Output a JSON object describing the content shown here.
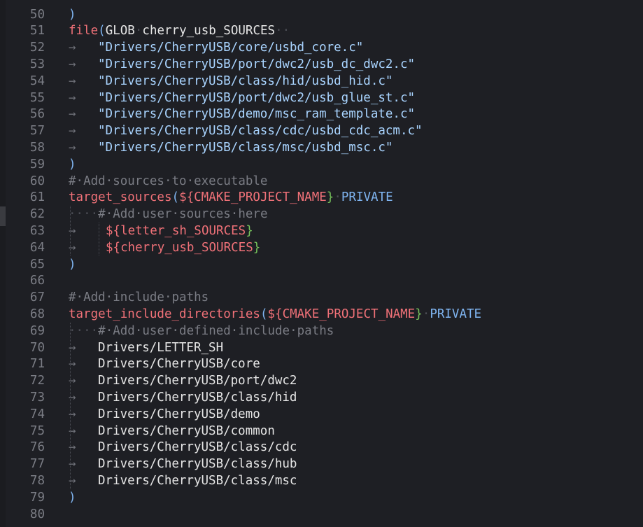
{
  "editor": {
    "language": "cmake",
    "lines": [
      {
        "n": "50",
        "tokens": [
          {
            "t": "paren",
            "v": ")"
          }
        ]
      },
      {
        "n": "51",
        "tokens": [
          {
            "t": "fn",
            "v": "file"
          },
          {
            "t": "paren",
            "v": "("
          },
          {
            "t": "pl",
            "v": "GLOB"
          },
          {
            "t": "ws",
            "v": "·"
          },
          {
            "t": "pl",
            "v": "cherry_usb_SOURCES"
          },
          {
            "t": "ws",
            "v": "·"
          },
          {
            "t": "ws",
            "v": "·"
          }
        ]
      },
      {
        "n": "52",
        "indent": "tab",
        "tokens": [
          {
            "t": "str",
            "v": "\"Drivers/CherryUSB/core/usbd_core.c\""
          }
        ]
      },
      {
        "n": "53",
        "indent": "tab",
        "tokens": [
          {
            "t": "str",
            "v": "\"Drivers/CherryUSB/port/dwc2/usb_dc_dwc2.c\""
          }
        ]
      },
      {
        "n": "54",
        "indent": "tab",
        "tokens": [
          {
            "t": "str",
            "v": "\"Drivers/CherryUSB/class/hid/usbd_hid.c\""
          }
        ]
      },
      {
        "n": "55",
        "indent": "tab",
        "tokens": [
          {
            "t": "str",
            "v": "\"Drivers/CherryUSB/port/dwc2/usb_glue_st.c\""
          }
        ]
      },
      {
        "n": "56",
        "indent": "tab",
        "tokens": [
          {
            "t": "str",
            "v": "\"Drivers/CherryUSB/demo/msc_ram_template.c\""
          }
        ]
      },
      {
        "n": "57",
        "indent": "tab",
        "tokens": [
          {
            "t": "str",
            "v": "\"Drivers/CherryUSB/class/cdc/usbd_cdc_acm.c\""
          }
        ]
      },
      {
        "n": "58",
        "indent": "tab",
        "tokens": [
          {
            "t": "str",
            "v": "\"Drivers/CherryUSB/class/msc/usbd_msc.c\""
          }
        ]
      },
      {
        "n": "59",
        "tokens": [
          {
            "t": "paren",
            "v": ")"
          }
        ]
      },
      {
        "n": "60",
        "tokens": [
          {
            "t": "cm",
            "v": "#·Add·sources·to·executable"
          }
        ]
      },
      {
        "n": "61",
        "tokens": [
          {
            "t": "fn",
            "v": "target_sources"
          },
          {
            "t": "paren",
            "v": "("
          },
          {
            "t": "vb",
            "v": "${"
          },
          {
            "t": "vn",
            "v": "CMAKE_PROJECT_NAME"
          },
          {
            "t": "br",
            "v": "}"
          },
          {
            "t": "ws",
            "v": "·"
          },
          {
            "t": "kw",
            "v": "PRIVATE"
          }
        ]
      },
      {
        "n": "62",
        "tokens": [
          {
            "t": "ws",
            "v": "····"
          },
          {
            "t": "cm",
            "v": "#·Add·user·sources·here"
          }
        ]
      },
      {
        "n": "63",
        "indent": "tab2",
        "tokens": [
          {
            "t": "vb",
            "v": "${"
          },
          {
            "t": "vn",
            "v": "letter_sh_SOURCES"
          },
          {
            "t": "br",
            "v": "}"
          }
        ]
      },
      {
        "n": "64",
        "indent": "tab2",
        "tokens": [
          {
            "t": "vb",
            "v": "${"
          },
          {
            "t": "vn",
            "v": "cherry_usb_SOURCES"
          },
          {
            "t": "br",
            "v": "}"
          }
        ]
      },
      {
        "n": "65",
        "tokens": [
          {
            "t": "paren",
            "v": ")"
          }
        ]
      },
      {
        "n": "66",
        "tokens": []
      },
      {
        "n": "67",
        "tokens": [
          {
            "t": "cm",
            "v": "#·Add·include·paths"
          }
        ]
      },
      {
        "n": "68",
        "tokens": [
          {
            "t": "fn",
            "v": "target_include_directories"
          },
          {
            "t": "paren",
            "v": "("
          },
          {
            "t": "vb",
            "v": "${"
          },
          {
            "t": "vn",
            "v": "CMAKE_PROJECT_NAME"
          },
          {
            "t": "br",
            "v": "}"
          },
          {
            "t": "ws",
            "v": "·"
          },
          {
            "t": "kw",
            "v": "PRIVATE"
          }
        ]
      },
      {
        "n": "69",
        "tokens": [
          {
            "t": "ws",
            "v": "····"
          },
          {
            "t": "cm",
            "v": "#·Add·user·defined·include·paths"
          }
        ]
      },
      {
        "n": "70",
        "indent": "tab",
        "tokens": [
          {
            "t": "pl",
            "v": "Drivers/LETTER_SH"
          }
        ]
      },
      {
        "n": "71",
        "indent": "tab",
        "tokens": [
          {
            "t": "pl",
            "v": "Drivers/CherryUSB/core"
          }
        ]
      },
      {
        "n": "72",
        "indent": "tab",
        "tokens": [
          {
            "t": "pl",
            "v": "Drivers/CherryUSB/port/dwc2"
          }
        ]
      },
      {
        "n": "73",
        "indent": "tab",
        "tokens": [
          {
            "t": "pl",
            "v": "Drivers/CherryUSB/class/hid"
          }
        ]
      },
      {
        "n": "74",
        "indent": "tab",
        "tokens": [
          {
            "t": "pl",
            "v": "Drivers/CherryUSB/demo"
          }
        ]
      },
      {
        "n": "75",
        "indent": "tab",
        "tokens": [
          {
            "t": "pl",
            "v": "Drivers/CherryUSB/common"
          }
        ]
      },
      {
        "n": "76",
        "indent": "tab",
        "tokens": [
          {
            "t": "pl",
            "v": "Drivers/CherryUSB/class/cdc"
          }
        ]
      },
      {
        "n": "77",
        "indent": "tab",
        "tokens": [
          {
            "t": "pl",
            "v": "Drivers/CherryUSB/class/hub"
          }
        ]
      },
      {
        "n": "78",
        "indent": "tab",
        "tokens": [
          {
            "t": "pl",
            "v": "Drivers/CherryUSB/class/msc"
          }
        ]
      },
      {
        "n": "79",
        "tokens": [
          {
            "t": "paren",
            "v": ")"
          }
        ]
      },
      {
        "n": "80",
        "tokens": []
      }
    ],
    "tab_glyph": "→",
    "colors": {
      "background": "#1e1f24",
      "line_number": "#7b7d85",
      "function": "#f07178",
      "string": "#a9d4ff",
      "comment": "#7a7c84",
      "keyword": "#7fb4f0",
      "brace_close": "#76c35b",
      "plain": "#e6e6e6"
    }
  }
}
